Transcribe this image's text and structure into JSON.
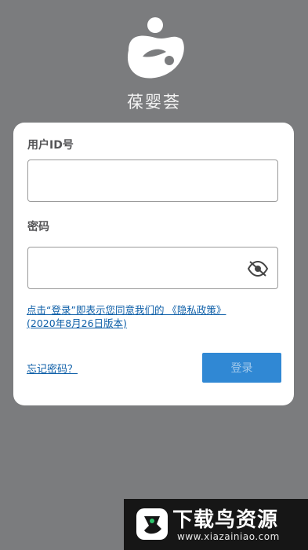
{
  "app": {
    "name": "葆婴荟"
  },
  "login": {
    "user_id_label": "用户ID号",
    "user_id_value": "",
    "password_label": "密码",
    "password_value": "",
    "policy_text_1": "点击“登录”即表示您同意我们的 《隐私政策》",
    "policy_text_2": "(2020年8月26日版本)",
    "forgot_label": "忘记密码？",
    "login_label": "登录"
  },
  "watermark": {
    "title": "下载鸟资源",
    "url": "www.xiazainiao.com"
  },
  "colors": {
    "background": "#7b7c7e",
    "accent": "#1f7ed1",
    "link": "#0e5fa8"
  }
}
